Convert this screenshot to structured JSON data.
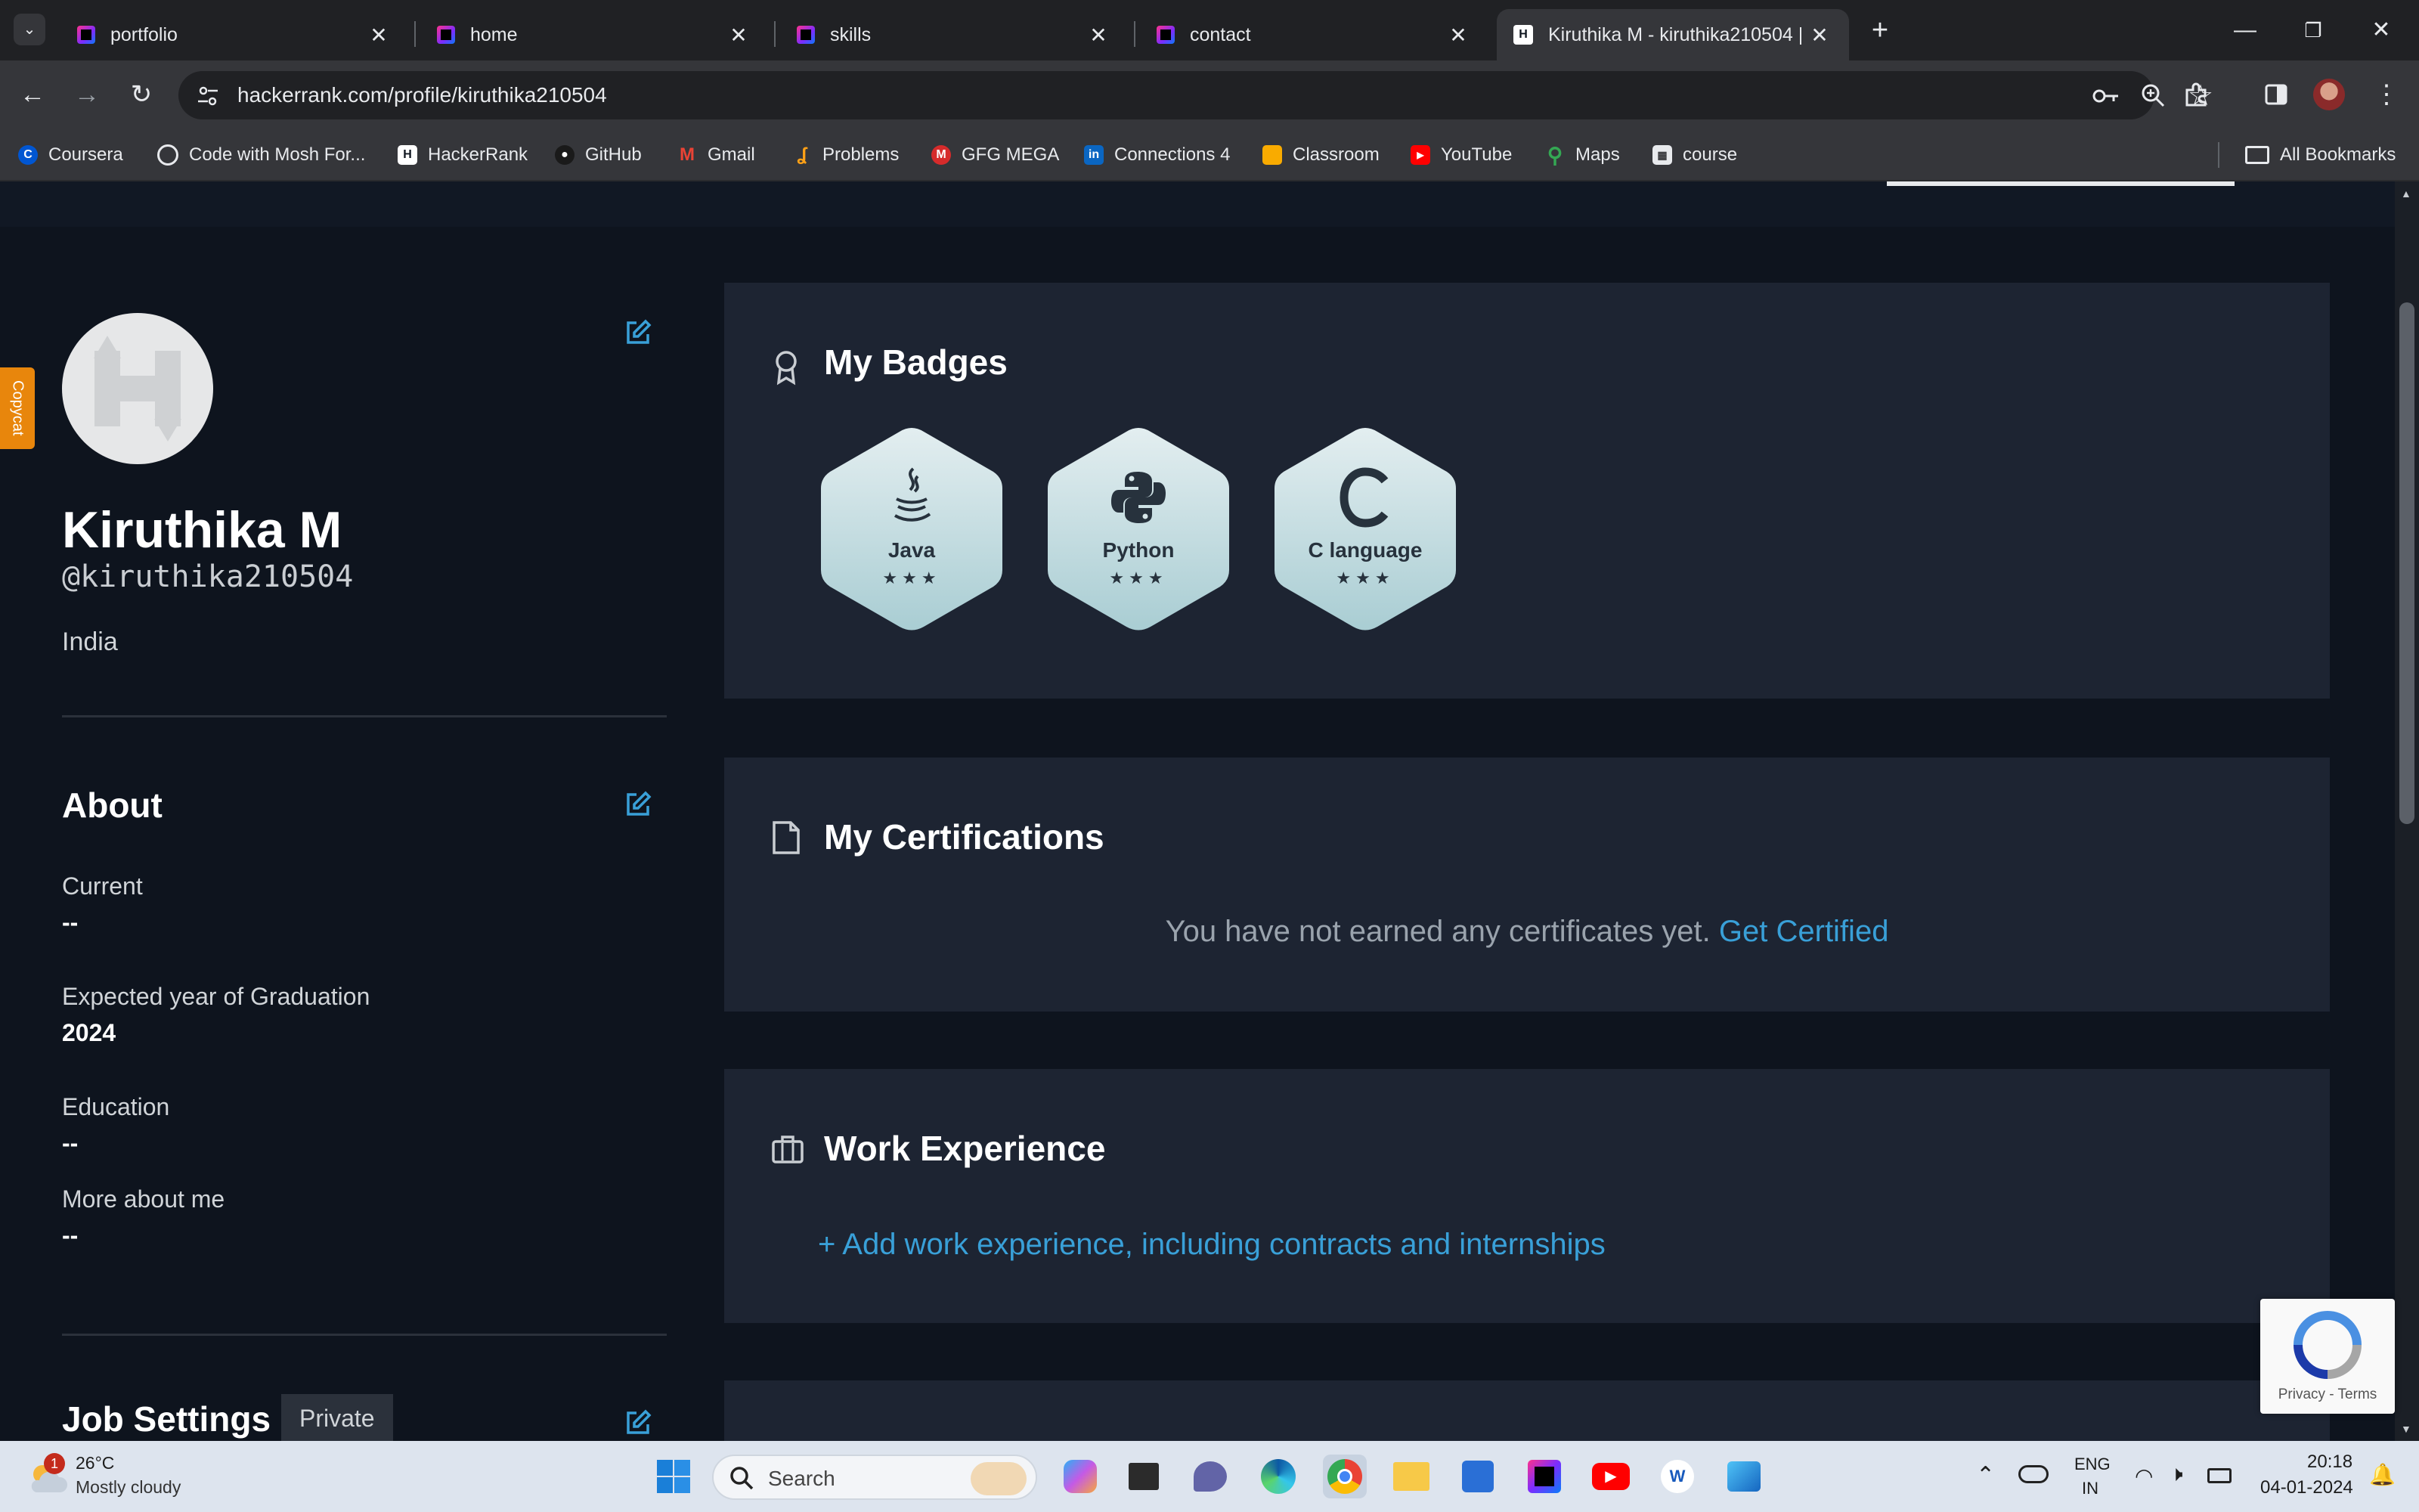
{
  "browser": {
    "tabs": [
      {
        "title": "portfolio"
      },
      {
        "title": "home"
      },
      {
        "title": "skills"
      },
      {
        "title": "contact"
      },
      {
        "title": "Kiruthika M - kiruthika210504 |"
      }
    ],
    "url": "hackerrank.com/profile/kiruthika210504",
    "bookmarks": [
      {
        "label": "Coursera"
      },
      {
        "label": "Code with Mosh For..."
      },
      {
        "label": "HackerRank"
      },
      {
        "label": "GitHub"
      },
      {
        "label": "Gmail"
      },
      {
        "label": "Problems"
      },
      {
        "label": "GFG MEGA"
      },
      {
        "label": "Connections 4"
      },
      {
        "label": "Classroom"
      },
      {
        "label": "YouTube"
      },
      {
        "label": "Maps"
      },
      {
        "label": "course"
      }
    ],
    "all_bookmarks": "All Bookmarks"
  },
  "extension": {
    "copycat_label": "Copycat"
  },
  "profile": {
    "name": "Kiruthika M",
    "username": "@kiruthika210504",
    "country": "India",
    "avatar_letter": "H"
  },
  "about": {
    "heading": "About",
    "fields": [
      {
        "label": "Current",
        "value": "--"
      },
      {
        "label": "Expected year of Graduation",
        "value": "2024"
      },
      {
        "label": "Education",
        "value": "--"
      },
      {
        "label": "More about me",
        "value": "--"
      }
    ]
  },
  "job_settings": {
    "heading": "Job Settings",
    "visibility": "Private"
  },
  "badges": {
    "heading": "My Badges",
    "items": [
      {
        "label": "Java",
        "stars": "★★★",
        "icon": "java-icon"
      },
      {
        "label": "Python",
        "stars": "★★★",
        "icon": "python-icon"
      },
      {
        "label": "C language",
        "stars": "★★★",
        "icon": "c-icon"
      }
    ]
  },
  "certifications": {
    "heading": "My Certifications",
    "empty_text": "You have not earned any certificates yet.",
    "link": "Get Certified"
  },
  "work": {
    "heading": "Work Experience",
    "add_link": "+ Add work experience, including contracts and internships"
  },
  "recaptcha": {
    "links": "Privacy - Terms"
  },
  "taskbar": {
    "weather_temp": "26°C",
    "weather_desc": "Mostly cloudy",
    "weather_badge": "1",
    "search_placeholder": "Search",
    "lang_top": "ENG",
    "lang_bottom": "IN",
    "time": "20:18",
    "date": "04-01-2024"
  }
}
